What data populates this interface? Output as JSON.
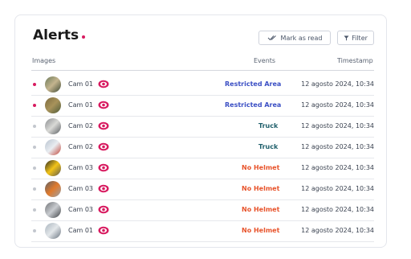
{
  "header": {
    "title": "Alerts",
    "mark_as_read": "Mark as read",
    "filter": "Filter"
  },
  "columns": {
    "images": "Images",
    "events": "Events",
    "timestamp": "Timestamp"
  },
  "colors": {
    "accent": "#d81b60",
    "restricted": "#3b4fc4",
    "truck": "#1f5f6b",
    "no_helmet": "#e8542c"
  },
  "rows": [
    {
      "unread": true,
      "camera": "Cam 01",
      "event": "Restricted Area",
      "event_type": "restricted",
      "timestamp": "12 agosto 2024, 10:34",
      "thumb": "forest"
    },
    {
      "unread": true,
      "camera": "Cam 01",
      "event": "Restricted Area",
      "event_type": "restricted",
      "timestamp": "12 agosto 2024, 10:34",
      "thumb": "trees"
    },
    {
      "unread": false,
      "camera": "Cam 02",
      "event": "Truck",
      "event_type": "truck",
      "timestamp": "12 agosto 2024, 10:34",
      "thumb": "road"
    },
    {
      "unread": false,
      "camera": "Cam 02",
      "event": "Truck",
      "event_type": "truck",
      "timestamp": "12 agosto 2024, 10:34",
      "thumb": "truck"
    },
    {
      "unread": false,
      "camera": "Cam 03",
      "event": "No Helmet",
      "event_type": "no_helmet",
      "timestamp": "12 agosto 2024, 10:34",
      "thumb": "worker-yellow"
    },
    {
      "unread": false,
      "camera": "Cam 03",
      "event": "No Helmet",
      "event_type": "no_helmet",
      "timestamp": "12 agosto 2024, 10:34",
      "thumb": "worker-orange"
    },
    {
      "unread": false,
      "camera": "Cam 03",
      "event": "No Helmet",
      "event_type": "no_helmet",
      "timestamp": "12 agosto 2024, 10:34",
      "thumb": "worker-grey"
    },
    {
      "unread": false,
      "camera": "Cam 01",
      "event": "No Helmet",
      "event_type": "no_helmet",
      "timestamp": "12 agosto 2024, 10:34",
      "thumb": "site"
    }
  ]
}
